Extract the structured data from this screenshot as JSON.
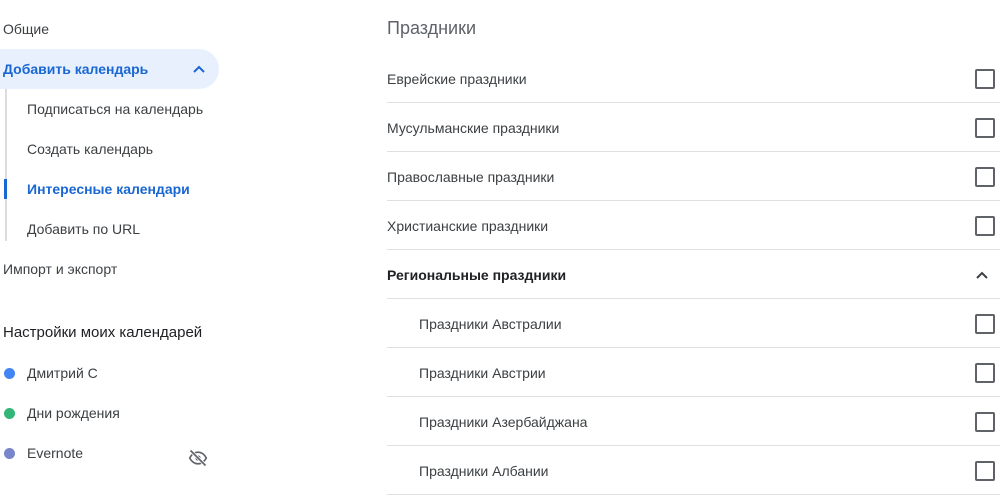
{
  "sidebar": {
    "general": "Общие",
    "add_calendar": "Добавить календарь",
    "sub_items": [
      "Подписаться на календарь",
      "Создать календарь",
      "Интересные календари",
      "Добавить по URL"
    ],
    "import_export": "Импорт и экспорт",
    "my_settings_title": "Настройки моих календарей",
    "calendars": [
      {
        "name": "Дмитрий С",
        "color": "#4285f4"
      },
      {
        "name": "Дни рождения",
        "color": "#33b679"
      },
      {
        "name": "Evernote",
        "color": "#7986cb"
      }
    ]
  },
  "main": {
    "title": "Праздники",
    "rows": [
      "Еврейские праздники",
      "Мусульманские праздники",
      "Православные праздники",
      "Христианские праздники"
    ],
    "regional_title": "Региональные праздники",
    "regional_rows": [
      "Праздники Австралии",
      "Праздники Австрии",
      "Праздники Азербайджана",
      "Праздники Албании"
    ]
  }
}
